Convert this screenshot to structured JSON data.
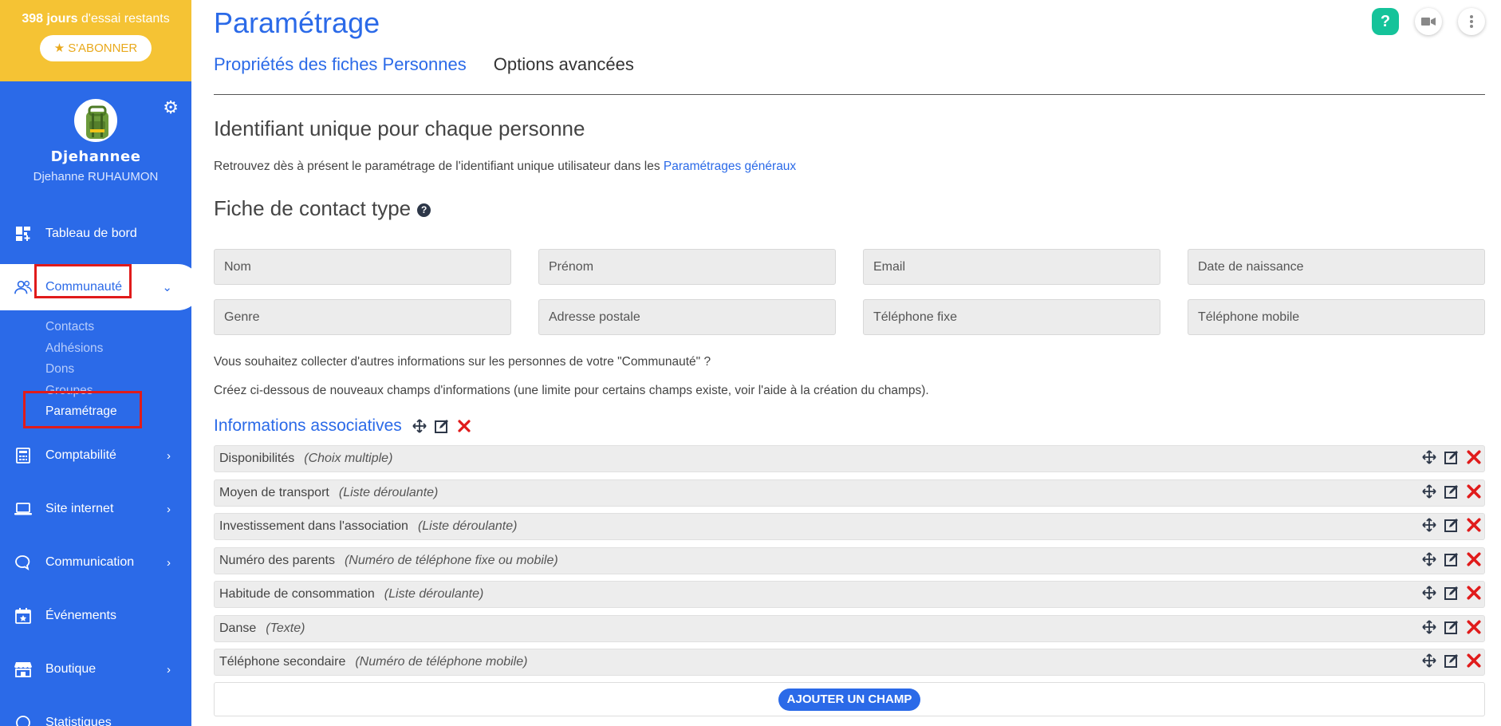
{
  "trial": {
    "days": "398 jours",
    "text": " d'essai restants",
    "subscribe": "S'ABONNER"
  },
  "profile": {
    "username": "Djehannee",
    "fullname": "Djehanne RUHAUMON"
  },
  "nav": {
    "dashboard": "Tableau de bord",
    "community": "Communauté",
    "community_sub": [
      "Contacts",
      "Adhésions",
      "Dons",
      "Groupes",
      "Paramétrage"
    ],
    "accounting": "Comptabilité",
    "website": "Site internet",
    "communication": "Communication",
    "events": "Événements",
    "shop": "Boutique",
    "stats": "Statistiques"
  },
  "page": {
    "title": "Paramétrage",
    "tabs": [
      "Propriétés des fiches Personnes",
      "Options avancées"
    ]
  },
  "unique_id": {
    "heading": "Identifiant unique pour chaque personne",
    "text": "Retrouvez dès à présent le paramétrage de l'identifiant unique utilisateur dans les ",
    "link": "Paramétrages généraux"
  },
  "contact_card": {
    "heading": "Fiche de contact type",
    "fields": [
      "Nom",
      "Prénom",
      "Email",
      "Date de naissance",
      "Genre",
      "Adresse postale",
      "Téléphone fixe",
      "Téléphone mobile"
    ],
    "question": "Vous souhaitez collecter d'autres informations sur les personnes de votre \"Communauté\" ?",
    "instructions": "Créez ci-dessous de nouveaux champs d'informations (une limite pour certains champs existe, voir l'aide à la création du champs)."
  },
  "custom": {
    "title": "Informations associatives",
    "rows": [
      {
        "name": "Disponibilités",
        "type": "(Choix multiple)"
      },
      {
        "name": "Moyen de transport",
        "type": "(Liste déroulante)"
      },
      {
        "name": "Investissement dans l'association",
        "type": "(Liste déroulante)"
      },
      {
        "name": "Numéro des parents",
        "type": "(Numéro de téléphone fixe ou mobile)"
      },
      {
        "name": "Habitude de consommation",
        "type": "(Liste déroulante)"
      },
      {
        "name": "Danse",
        "type": "(Texte)"
      },
      {
        "name": "Téléphone secondaire",
        "type": "(Numéro de téléphone mobile)"
      }
    ],
    "add_button": "AJOUTER UN CHAMP"
  },
  "colors": {
    "primary": "#2b6ae8",
    "trial_bg": "#f5c334",
    "danger": "#e01b1b",
    "help": "#15c39a"
  }
}
